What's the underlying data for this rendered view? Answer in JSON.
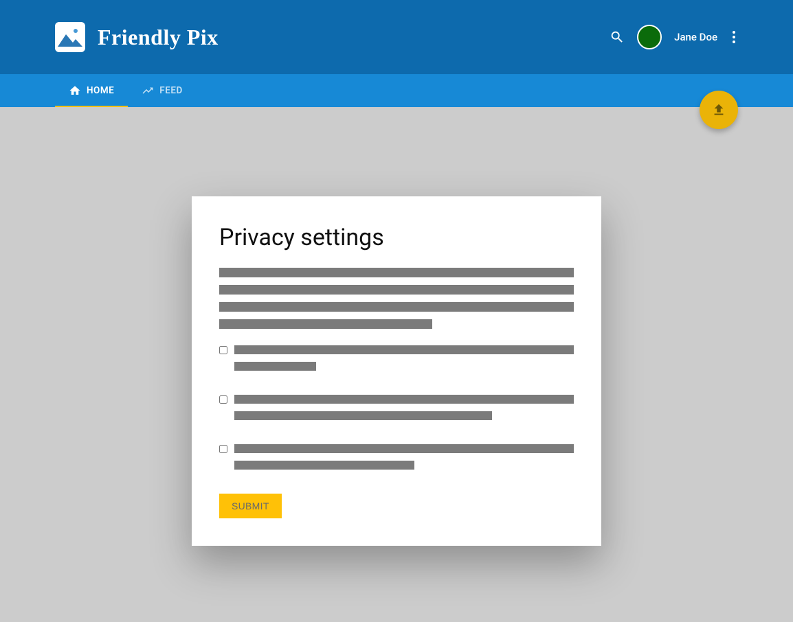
{
  "app": {
    "title": "Friendly Pix"
  },
  "user": {
    "name": "Jane Doe",
    "avatar_color": "#0b6b0b"
  },
  "tabs": [
    {
      "label": "HOME",
      "icon": "home-icon",
      "active": true
    },
    {
      "label": "FEED",
      "icon": "trending-icon",
      "active": false
    }
  ],
  "privacy_card": {
    "title": "Privacy settings",
    "submit_label": "SUBMIT",
    "checkboxes": [
      {
        "checked": false
      },
      {
        "checked": false
      },
      {
        "checked": false
      }
    ]
  }
}
